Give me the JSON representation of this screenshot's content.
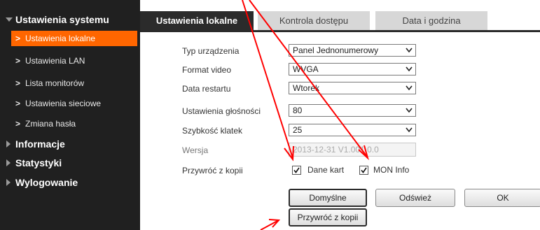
{
  "sidebar": {
    "header": "Ustawienia systemu",
    "items": [
      {
        "label": "Ustawienia lokalne",
        "active": true
      },
      {
        "label": "Ustawienia LAN"
      },
      {
        "label": "Lista monitorów"
      },
      {
        "label": "Ustawienia sieciowe"
      },
      {
        "label": "Zmiana hasła"
      }
    ],
    "sections": [
      "Informacje",
      "Statystyki",
      "Wylogowanie"
    ]
  },
  "tabs": [
    "Ustawienia lokalne",
    "Kontrola dostępu",
    "Data i godzina"
  ],
  "form": {
    "device_type": {
      "label": "Typ urządzenia",
      "value": "Panel Jednonumerowy"
    },
    "video_format": {
      "label": "Format video",
      "value": "WVGA"
    },
    "restart_date": {
      "label": "Data restartu",
      "value": "Wtorek"
    },
    "volume": {
      "label": "Ustawienia głośności",
      "value": "80"
    },
    "frame_rate": {
      "label": "Szybkość klatek",
      "value": "25"
    },
    "version": {
      "label": "Wersja",
      "value": "2013-12-31 V1.001.0.0"
    },
    "restore": {
      "label": "Przywróć z kopii",
      "opt1": "Dane kart",
      "opt2": "MON Info",
      "opt1_checked": true,
      "opt2_checked": true
    }
  },
  "buttons": {
    "default": "Domyślne",
    "refresh": "Odśwież",
    "ok": "OK",
    "restore": "Przywróć z kopii"
  },
  "colors": {
    "accent": "#ff6600",
    "sidebar_bg": "#202020",
    "annotation": "#ff0000"
  },
  "icons": [
    "chevron-right-icon",
    "triangle-down-icon",
    "triangle-right-icon",
    "dropdown-arrow-icon",
    "checkmark-icon",
    "red-arrow"
  ]
}
